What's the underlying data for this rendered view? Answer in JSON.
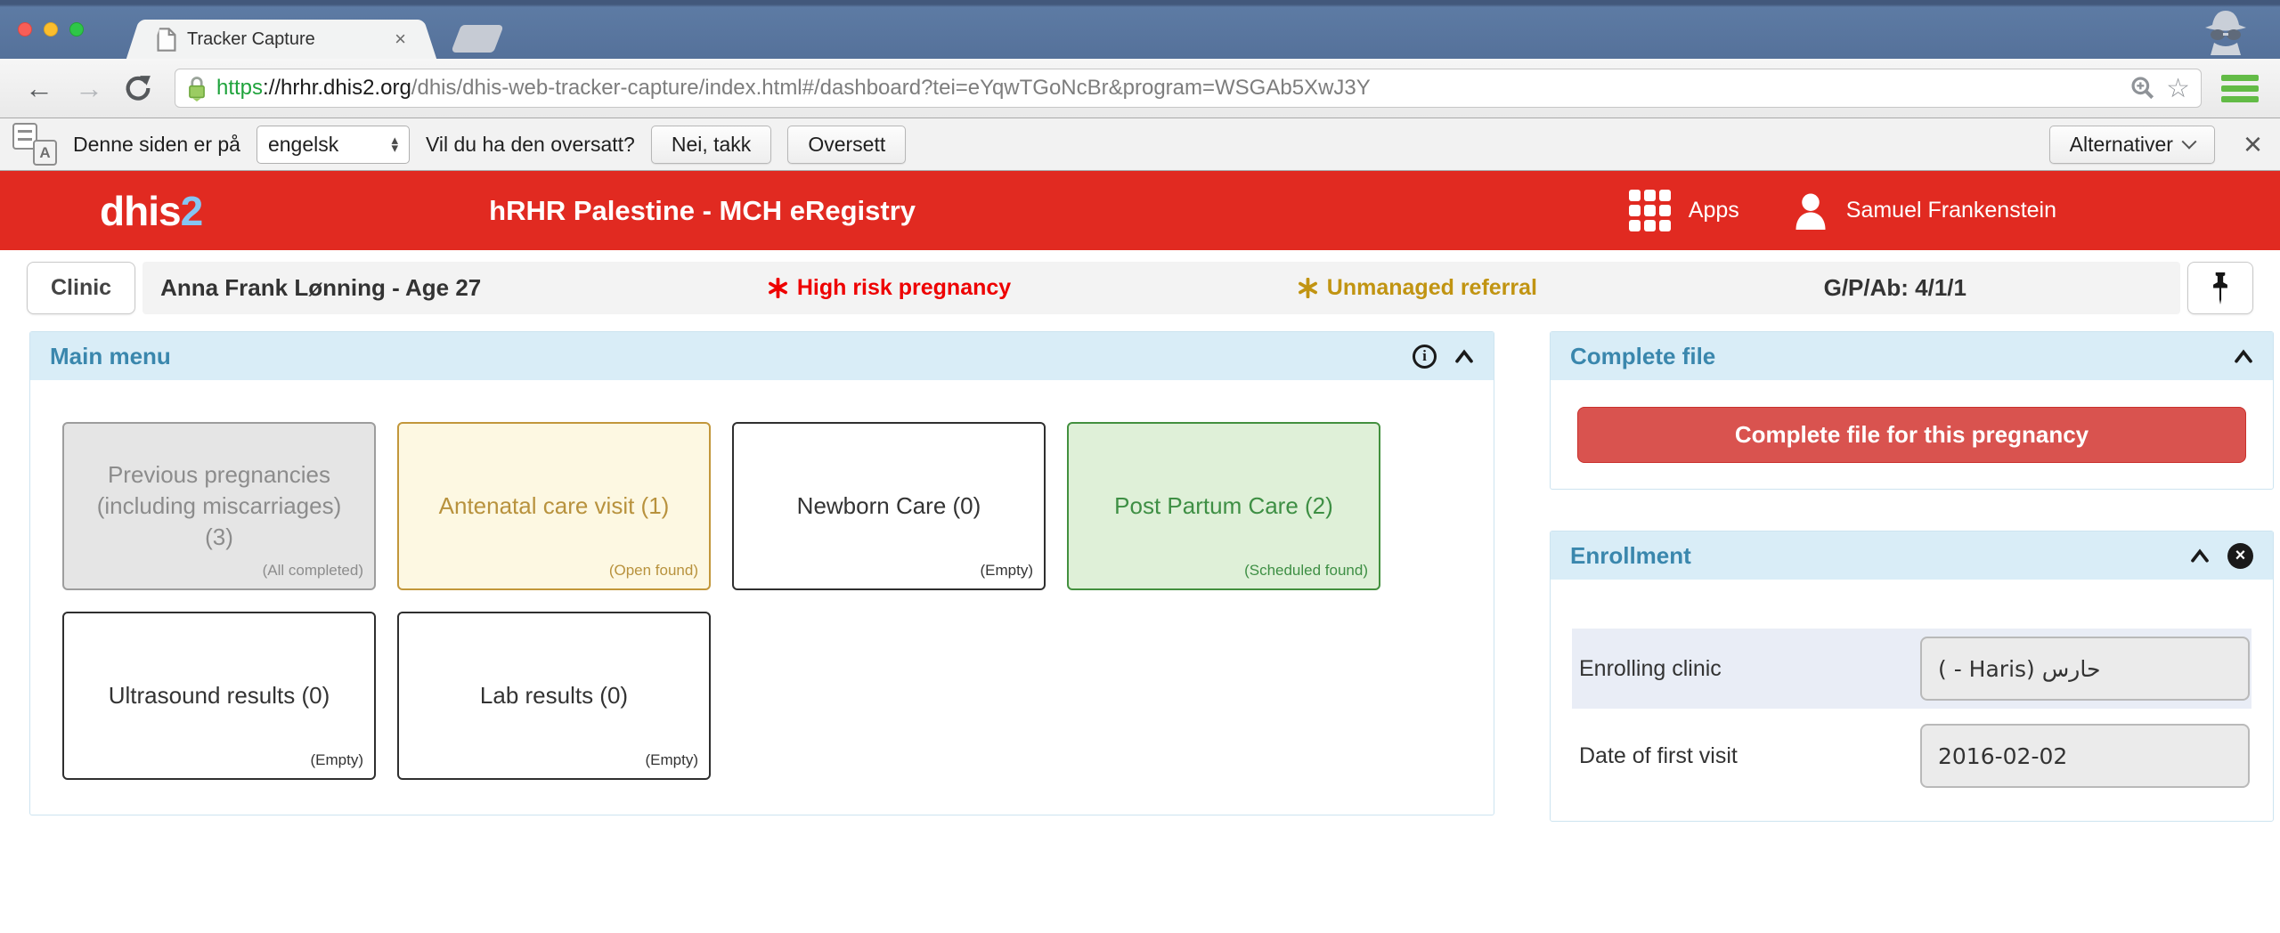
{
  "browser": {
    "tab_title": "Tracker Capture",
    "url_scheme": "https",
    "url_host": "://hrhr.dhis2.org",
    "url_path": "/dhis/dhis-web-tracker-capture/index.html#/dashboard?tei=eYqwTGoNcBr&program=WSGAb5XwJ3Y"
  },
  "translate_bar": {
    "message": "Denne siden er på",
    "language_selected": "engelsk",
    "question": "Vil du ha den oversatt?",
    "decline_label": "Nei, takk",
    "accept_label": "Oversett",
    "options_label": "Alternativer"
  },
  "app_header": {
    "logo_text": "dhis",
    "logo_suffix": "2",
    "title": "hRHR Palestine - MCH eRegistry",
    "apps_label": "Apps",
    "user_name": "Samuel Frankenstein"
  },
  "patient_bar": {
    "org_unit_label": "Clinic",
    "patient_name": "Anna Frank Lønning - Age 27",
    "flags": [
      {
        "label": "High risk pregnancy",
        "color": "#ee0000"
      },
      {
        "label": "Unmanaged referral",
        "color": "#c19412"
      }
    ],
    "gpab_label": "G/P/Ab: 4/1/1"
  },
  "main_menu": {
    "title": "Main menu",
    "cards": [
      {
        "label": "Previous pregnancies (including miscarriages) (3)",
        "status": "(All completed)",
        "state": "completed"
      },
      {
        "label": "Antenatal care visit (1)",
        "status": "(Open found)",
        "state": "open"
      },
      {
        "label": "Newborn Care (0)",
        "status": "(Empty)",
        "state": "empty"
      },
      {
        "label": "Post Partum Care (2)",
        "status": "(Scheduled found)",
        "state": "scheduled"
      },
      {
        "label": "Ultrasound results (0)",
        "status": "(Empty)",
        "state": "empty"
      },
      {
        "label": "Lab results (0)",
        "status": "(Empty)",
        "state": "empty"
      }
    ]
  },
  "complete_file": {
    "title": "Complete file",
    "button_label": "Complete file for this pregnancy"
  },
  "enrollment": {
    "title": "Enrollment",
    "fields": [
      {
        "label": "Enrolling clinic",
        "value": "( - Haris) حارس"
      },
      {
        "label": "Date of first visit",
        "value": "2016-02-02"
      }
    ]
  },
  "icons": {
    "back": "←",
    "forward": "→",
    "star": "☆",
    "tab_close": "×",
    "infobar_close": "×",
    "select_up": "▴",
    "select_down": "▾",
    "translate_front": "A",
    "info": "i",
    "circle_close": "×"
  },
  "colors": {
    "brand_red": "#e12a21",
    "panel_header_bg": "#d9edf7",
    "panel_title_blue": "#3a87ad",
    "danger_button": "#d9534f",
    "high_risk": "#ee0000",
    "unmanaged_referral": "#c19412",
    "secure_green": "#1fa33c",
    "card_open_border": "#c2973b",
    "card_scheduled_border": "#43903f"
  }
}
